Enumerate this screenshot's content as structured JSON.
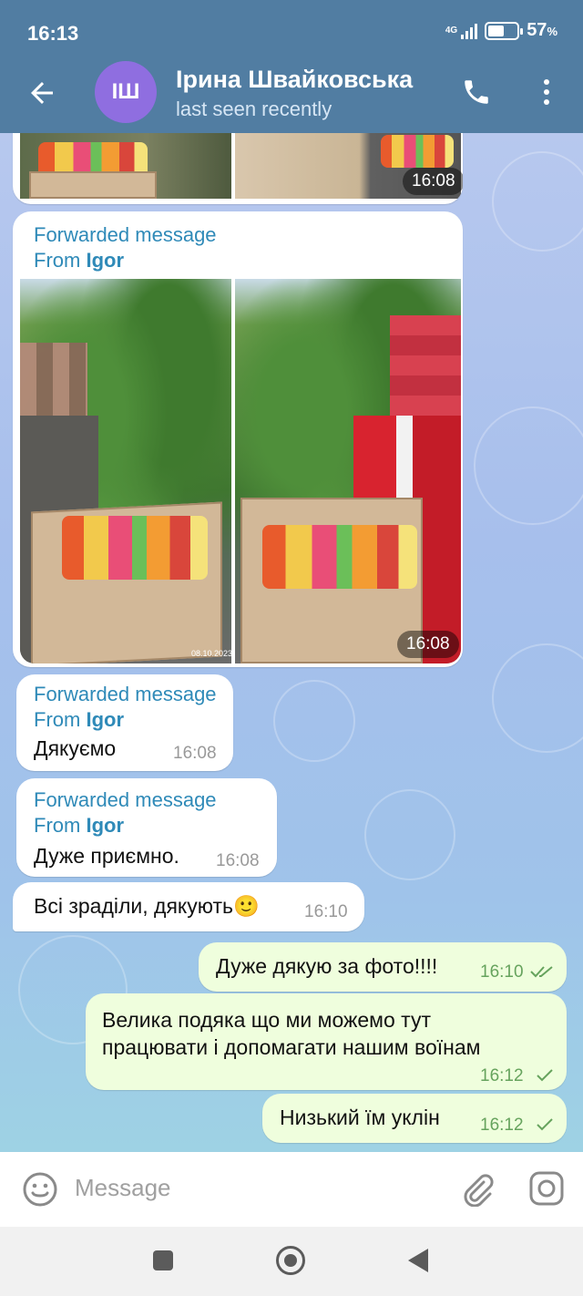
{
  "status_bar": {
    "time": "16:13",
    "network": "4G",
    "battery_percent": "57",
    "battery_unit": "%",
    "battery_level": 0.57
  },
  "header": {
    "avatar_initials": "ІШ",
    "name": "Ірина Швайковська",
    "status": "last seen recently"
  },
  "messages": {
    "album_top": {
      "time": "16:08"
    },
    "album_fwd": {
      "forwarded_label": "Forwarded message",
      "from_prefix": "From",
      "from_name": "Igor",
      "time": "16:08",
      "date_stamp": "08.10.2023"
    },
    "fwd1": {
      "forwarded_label": "Forwarded message",
      "from_prefix": "From",
      "from_name": "Igor",
      "text": "Дякуємо",
      "time": "16:08"
    },
    "fwd2": {
      "forwarded_label": "Forwarded message",
      "from_prefix": "From",
      "from_name": "Igor",
      "text": "Дуже приємно.",
      "time": "16:08"
    },
    "in1": {
      "text": "Всі зраділи, дякують",
      "emoji": "🙂",
      "time": "16:10"
    },
    "out1": {
      "text": "Дуже дякую за фото!!!!",
      "time": "16:10",
      "status": "read"
    },
    "out2": {
      "line1": "Велика подяка що ми можемо тут",
      "line2": "працювати  і допомагати нашим воїнам",
      "time": "16:12",
      "status": "sent"
    },
    "out3": {
      "text": "Низький їм уклін",
      "time": "16:12",
      "status": "sent"
    }
  },
  "input": {
    "placeholder": "Message"
  },
  "colors": {
    "header": "#517da2",
    "outgoing_bubble": "#effedd",
    "link": "#2f8ab8",
    "check": "#66a35d"
  },
  "icons": [
    "back-arrow-icon",
    "phone-icon",
    "more-vertical-icon",
    "emoji-icon",
    "attach-icon",
    "camera-icon",
    "double-check-icon",
    "single-check-icon"
  ]
}
